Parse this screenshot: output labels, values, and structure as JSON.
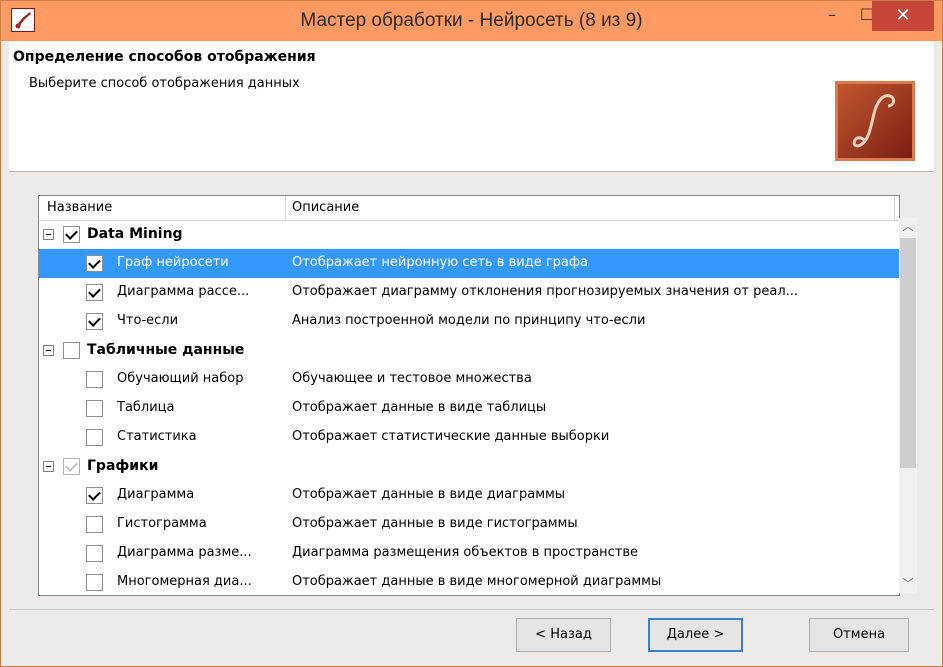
{
  "window": {
    "title": "Мастер обработки - Нейросеть (8 из 9)",
    "min_glyph": "–",
    "max_glyph": "☐",
    "close_glyph": "✕"
  },
  "header": {
    "title": "Определение способов отображения",
    "subtitle": "Выберите способ отображения данных"
  },
  "list": {
    "columns": {
      "name": "Название",
      "description": "Описание"
    },
    "rows": [
      {
        "type": "group",
        "name": "Data Mining",
        "check": "checked"
      },
      {
        "type": "item",
        "name": "Граф нейросети",
        "description": "Отображает нейронную сеть в виде графа",
        "check": "checked",
        "selected": true
      },
      {
        "type": "item",
        "name": "Диаграмма рассе...",
        "description": "Отображает диаграмму отклонения прогнозируемых значения от реал...",
        "check": "checked"
      },
      {
        "type": "item",
        "name": "Что-если",
        "description": "Анализ построенной модели по принципу что-если",
        "check": "checked"
      },
      {
        "type": "group",
        "name": "Табличные данные",
        "check": "unchecked"
      },
      {
        "type": "item",
        "name": "Обучающий набор",
        "description": "Обучающее и тестовое множества",
        "check": "unchecked"
      },
      {
        "type": "item",
        "name": "Таблица",
        "description": "Отображает данные в виде таблицы",
        "check": "unchecked"
      },
      {
        "type": "item",
        "name": "Статистика",
        "description": "Отображает статистические данные выборки",
        "check": "unchecked"
      },
      {
        "type": "group",
        "name": "Графики",
        "check": "partial"
      },
      {
        "type": "item",
        "name": "Диаграмма",
        "description": "Отображает данные в виде диаграммы",
        "check": "checked"
      },
      {
        "type": "item",
        "name": "Гистограмма",
        "description": "Отображает данные в виде гистограммы",
        "check": "unchecked"
      },
      {
        "type": "item",
        "name": "Диаграмма разме...",
        "description": "Диаграмма размещения объектов в пространстве",
        "check": "unchecked"
      },
      {
        "type": "item",
        "name": "Многомерная диа...",
        "description": "Отображает данные в виде многомерной диаграммы",
        "check": "unchecked"
      }
    ]
  },
  "buttons": {
    "back": "< Назад",
    "next": "Далее >",
    "cancel": "Отмена"
  },
  "colors": {
    "titlebar": "#ff9a63",
    "selection": "#3399ff",
    "close": "#c7463a"
  }
}
